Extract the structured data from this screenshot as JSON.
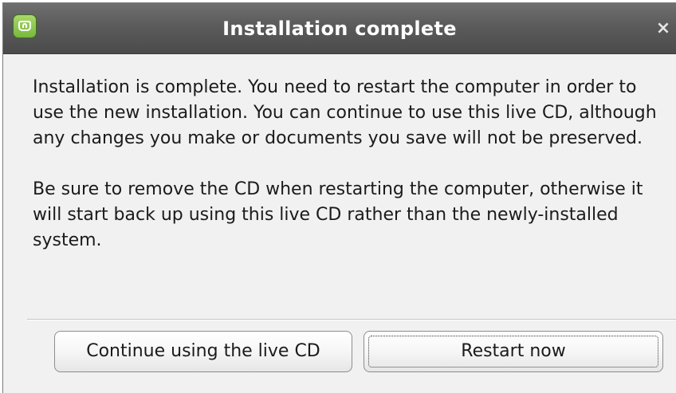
{
  "window": {
    "title": "Installation complete",
    "app_icon": "linux-mint-icon",
    "close_icon": "close-icon",
    "close_glyph": "×"
  },
  "message": {
    "paragraph1": "Installation is complete. You need to restart the computer in order to use the new installation. You can continue to use this live CD, although any changes you make or documents you save will not be preserved.",
    "paragraph2": "Be sure to remove the CD when restarting the computer, otherwise it will start back up using this live CD rather than the newly-installed system."
  },
  "buttons": {
    "continue_label": "Continue using the live CD",
    "restart_label": "Restart now"
  },
  "colors": {
    "titlebar": "#5b5b5b",
    "title_text": "#ffffff",
    "dialog_background": "#f1f1f1",
    "icon_green": "#8bc34a"
  }
}
